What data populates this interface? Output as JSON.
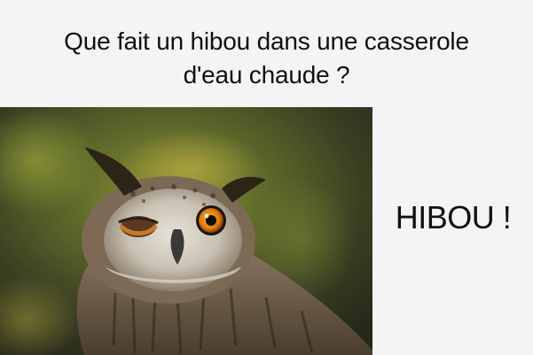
{
  "meme": {
    "question_line_1": "Que fait un hibou dans une casserole",
    "question_line_2": "d'eau chaude ?",
    "answer": "HIBOU !"
  },
  "photo": {
    "subject": "owl-winking",
    "colors": {
      "background": "#f4f4f4",
      "text": "#111111",
      "eye_orange": "#e07b10",
      "bokeh_green": "#7b8a2a"
    }
  }
}
